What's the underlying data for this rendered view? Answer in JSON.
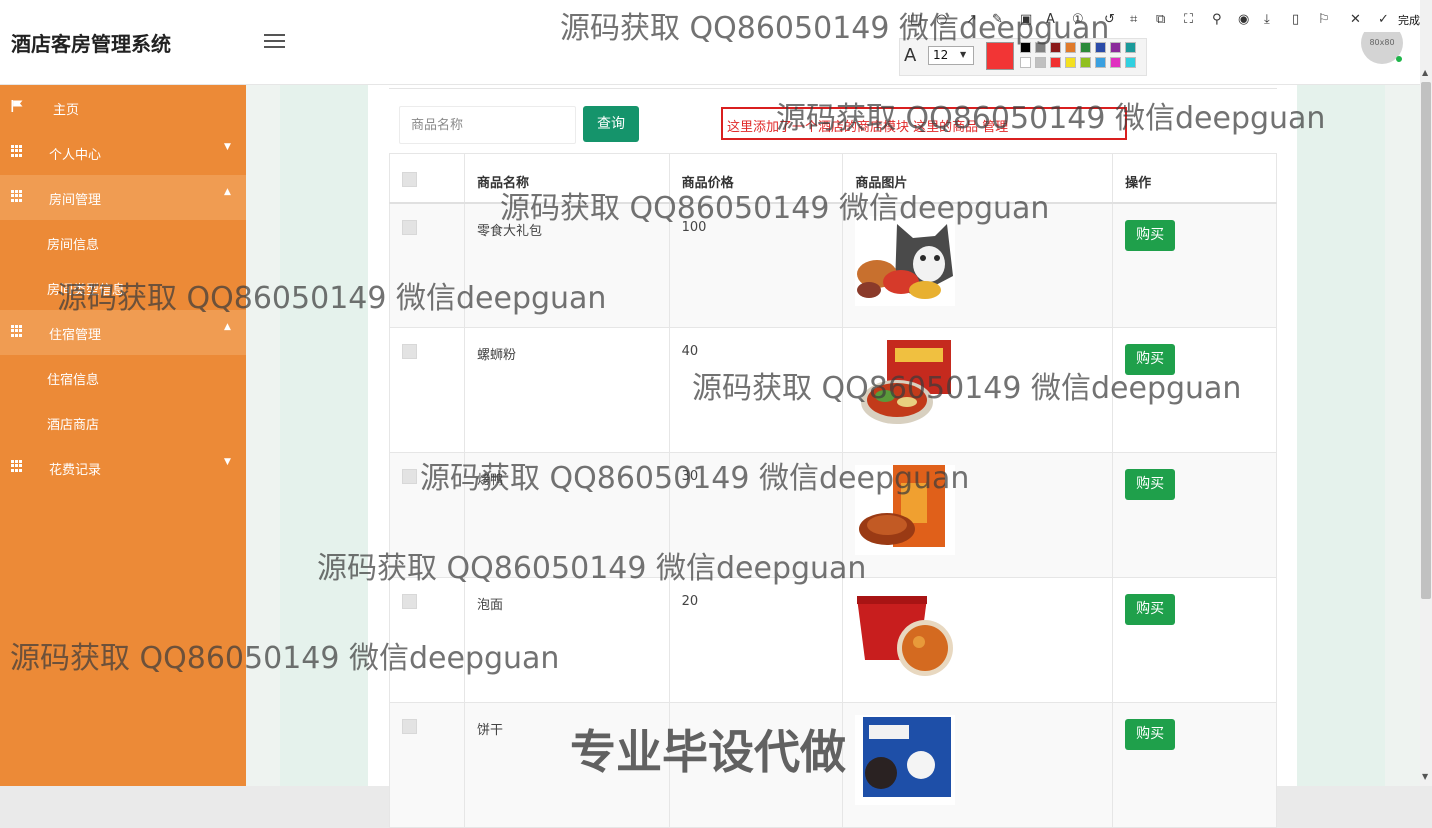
{
  "app": {
    "title": "酒店客房管理系统",
    "avatar_text": "80x80"
  },
  "sidebar": {
    "items": [
      {
        "label": "主页"
      },
      {
        "label": "个人中心"
      },
      {
        "label": "房间管理"
      },
      {
        "label": "房间信息"
      },
      {
        "label": "房间类型信息"
      },
      {
        "label": "住宿管理"
      },
      {
        "label": "住宿信息"
      },
      {
        "label": "酒店商店"
      },
      {
        "label": "花费记录"
      }
    ]
  },
  "search": {
    "placeholder": "商品名称",
    "button_label": "查询"
  },
  "annotation": {
    "text": "这里添加了一个酒店的商店模块 这里的商品 管理"
  },
  "table": {
    "headers": [
      "商品名称",
      "商品价格",
      "商品图片",
      "操作"
    ],
    "rows": [
      {
        "name": "零食大礼包",
        "price": "100",
        "action": "购买"
      },
      {
        "name": "螺蛳粉",
        "price": "40",
        "action": "购买"
      },
      {
        "name": "烤鸭",
        "price": "30",
        "action": "购买"
      },
      {
        "name": "泡面",
        "price": "20",
        "action": "购买"
      },
      {
        "name": "饼干",
        "price": "",
        "action": "购买"
      }
    ]
  },
  "editor_toolbar": {
    "font_size": "12",
    "done_label": "完成",
    "current_color": "#f23535"
  },
  "watermarks": {
    "text": "源码获取 QQ86050149 微信deepguan",
    "promo": "专业毕设代做"
  },
  "colors": {
    "sidebar": "#ec8a37",
    "query_button": "#15946b",
    "buy_button": "#1fa04b",
    "annotation": "#d91f1f"
  }
}
